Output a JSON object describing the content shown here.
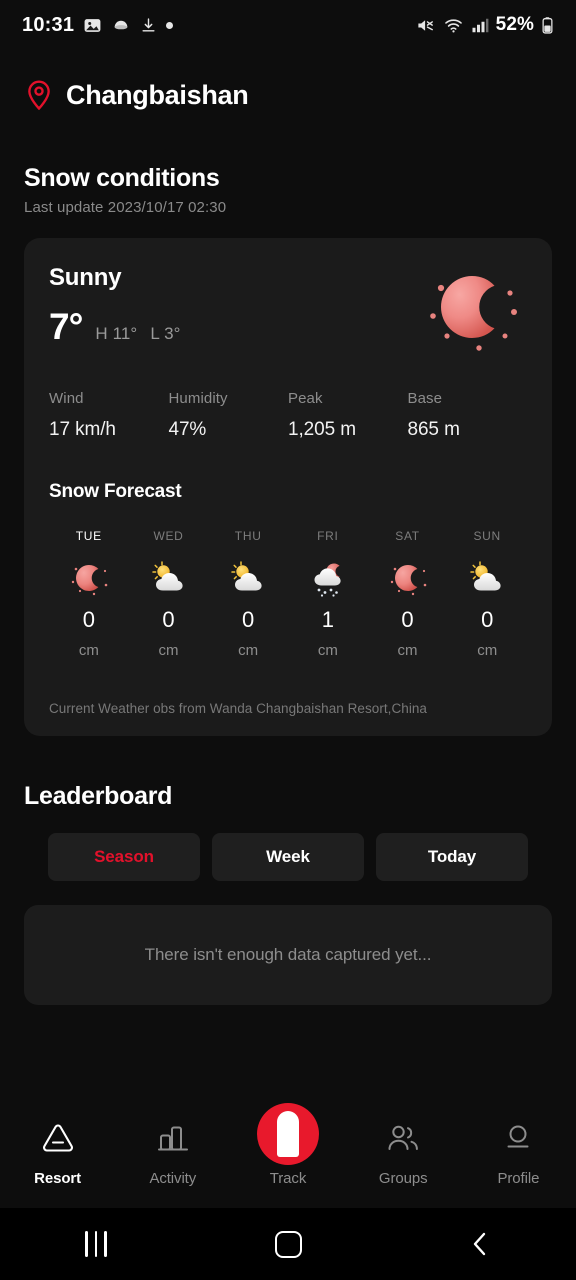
{
  "status_bar": {
    "time": "10:31",
    "left_icons": [
      "image-icon",
      "capsule-icon",
      "download-icon",
      "dot-icon"
    ],
    "right_icons": [
      "mute-icon",
      "wifi-icon",
      "signal-icon"
    ],
    "battery_percent": "52%"
  },
  "header": {
    "resort_name": "Changbaishan",
    "location_icon": "location-pin-icon"
  },
  "snow_conditions": {
    "title": "Snow conditions",
    "last_update": "Last update 2023/10/17 02:30",
    "condition": "Sunny",
    "condition_icon": "crescent-moon-icon",
    "temperature": "7°",
    "high": "H 11°",
    "low": "L 3°",
    "stats": [
      {
        "label": "Wind",
        "value": "17 km/h"
      },
      {
        "label": "Humidity",
        "value": "47%"
      },
      {
        "label": "Peak",
        "value": "1,205 m"
      },
      {
        "label": "Base",
        "value": "865 m"
      }
    ],
    "forecast_title": "Snow Forecast",
    "forecast": [
      {
        "day": "TUE",
        "icon": "crescent-moon-icon",
        "value": "0",
        "unit": "cm",
        "today": true
      },
      {
        "day": "WED",
        "icon": "sun-behind-cloud-icon",
        "value": "0",
        "unit": "cm",
        "today": false
      },
      {
        "day": "THU",
        "icon": "sun-behind-cloud-icon",
        "value": "0",
        "unit": "cm",
        "today": false
      },
      {
        "day": "FRI",
        "icon": "snow-cloud-moon-icon",
        "value": "1",
        "unit": "cm",
        "today": false
      },
      {
        "day": "SAT",
        "icon": "crescent-moon-icon",
        "value": "0",
        "unit": "cm",
        "today": false
      },
      {
        "day": "SUN",
        "icon": "sun-behind-cloud-icon",
        "value": "0",
        "unit": "cm",
        "today": false
      }
    ],
    "source_note": "Current Weather obs from Wanda Changbaishan Resort,China"
  },
  "leaderboard": {
    "title": "Leaderboard",
    "tabs": [
      {
        "label": "Season",
        "active": true
      },
      {
        "label": "Week",
        "active": false
      },
      {
        "label": "Today",
        "active": false
      }
    ],
    "empty_message": "There isn't enough data captured yet..."
  },
  "bottom_nav": [
    {
      "label": "Resort",
      "icon": "mountain-icon",
      "active": true
    },
    {
      "label": "Activity",
      "icon": "bar-chart-icon",
      "active": false
    },
    {
      "label": "Track",
      "icon": "track-record-icon",
      "active": false
    },
    {
      "label": "Groups",
      "icon": "people-icon",
      "active": false
    },
    {
      "label": "Profile",
      "icon": "person-icon",
      "active": false
    }
  ],
  "system_nav": {
    "recents": "recents-icon",
    "home": "home-icon",
    "back": "back-icon"
  },
  "colors": {
    "accent_red": "#e3112b",
    "fab_red": "#e8192c",
    "card_bg": "#1b1b1b",
    "page_bg": "#0d0d0d"
  }
}
